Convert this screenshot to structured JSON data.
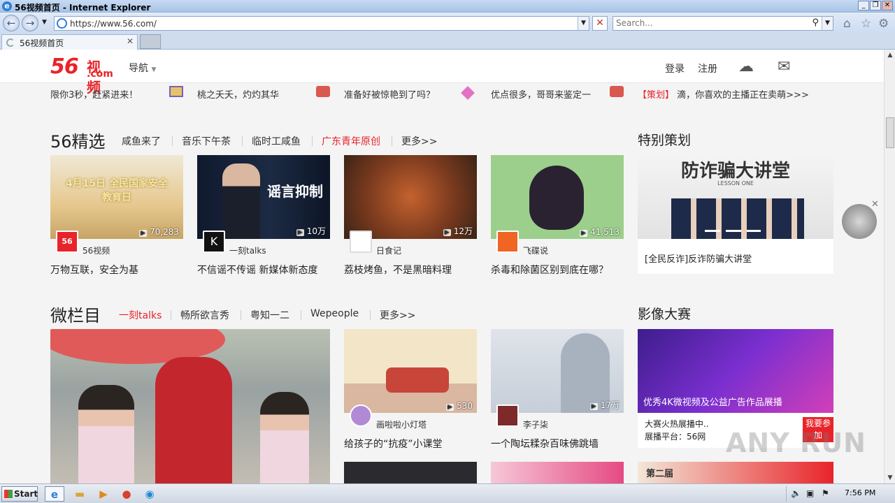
{
  "window": {
    "title": "56视频首页 - Internet Explorer"
  },
  "browser": {
    "url": "https://www.56.com/",
    "search_placeholder": "Search...",
    "tab_label": "56视频首页"
  },
  "site": {
    "logo_num": "56",
    "logo_text": "视频",
    "logo_com": ".com",
    "nav_label": "导航",
    "login": "登录",
    "register": "注册"
  },
  "ticker": [
    "限你3秒，赶紧进来！",
    "桃之夭夭，灼灼其华",
    "准备好被惊艳到了吗？",
    "优点很多，哥哥来鉴定一",
    "滴，你喜欢的主播正在卖萌>>>"
  ],
  "ticker_tag": "【策划】",
  "section1": {
    "title": "56精选",
    "links": [
      "咸鱼来了",
      "音乐下午茶",
      "临时工咸鱼",
      "广东青年原创",
      "更多>>"
    ],
    "cards": [
      {
        "count": "70,283",
        "author": "56视频",
        "title": "万物互联，安全为基",
        "thumb_text": "4月15日 全民国家安全教育日"
      },
      {
        "count": "10万",
        "author": "一刻talks",
        "title": "不信谣不传谣 新媒体新态度",
        "thumb_text": "谣言抑制"
      },
      {
        "count": "12万",
        "author": "日食记",
        "title": "荔枝烤鱼，不是黑暗料理"
      },
      {
        "count": "41,513",
        "author": "飞碟说",
        "title": "杀毒和除菌区别到底在哪？"
      }
    ]
  },
  "special": {
    "title": "特别策划",
    "banner_text": "防诈骗大讲堂",
    "banner_sub": "LESSON ONE",
    "caption": "[全民反诈]反诈防骗大讲堂"
  },
  "section2": {
    "title": "微栏目",
    "links": [
      "一刻talks",
      "畅所欲言秀",
      "粤知一二",
      "Wepeople",
      "更多>>"
    ],
    "cards": [
      {
        "count": "530",
        "author": "画啦啦小灯塔",
        "title": "给孩子的“抗疫”小课堂"
      },
      {
        "count": "17万",
        "author": "李子柒",
        "title": "一个陶坛糅杂百味佛跳墙"
      }
    ]
  },
  "contest": {
    "title": "影像大赛",
    "banner_text": "优秀4K微视频及公益广告作品展播",
    "line1": "大赛火热展播中..",
    "line2": "展播平台：56网",
    "join_btn": "我要参加",
    "next_banner": "第二届"
  },
  "taskbar": {
    "start": "Start",
    "clock": "7:56 PM"
  },
  "watermark": "ANY RUN",
  "colors": {
    "brand_red": "#e8242a",
    "accent_blue": "#2f7fd6"
  }
}
